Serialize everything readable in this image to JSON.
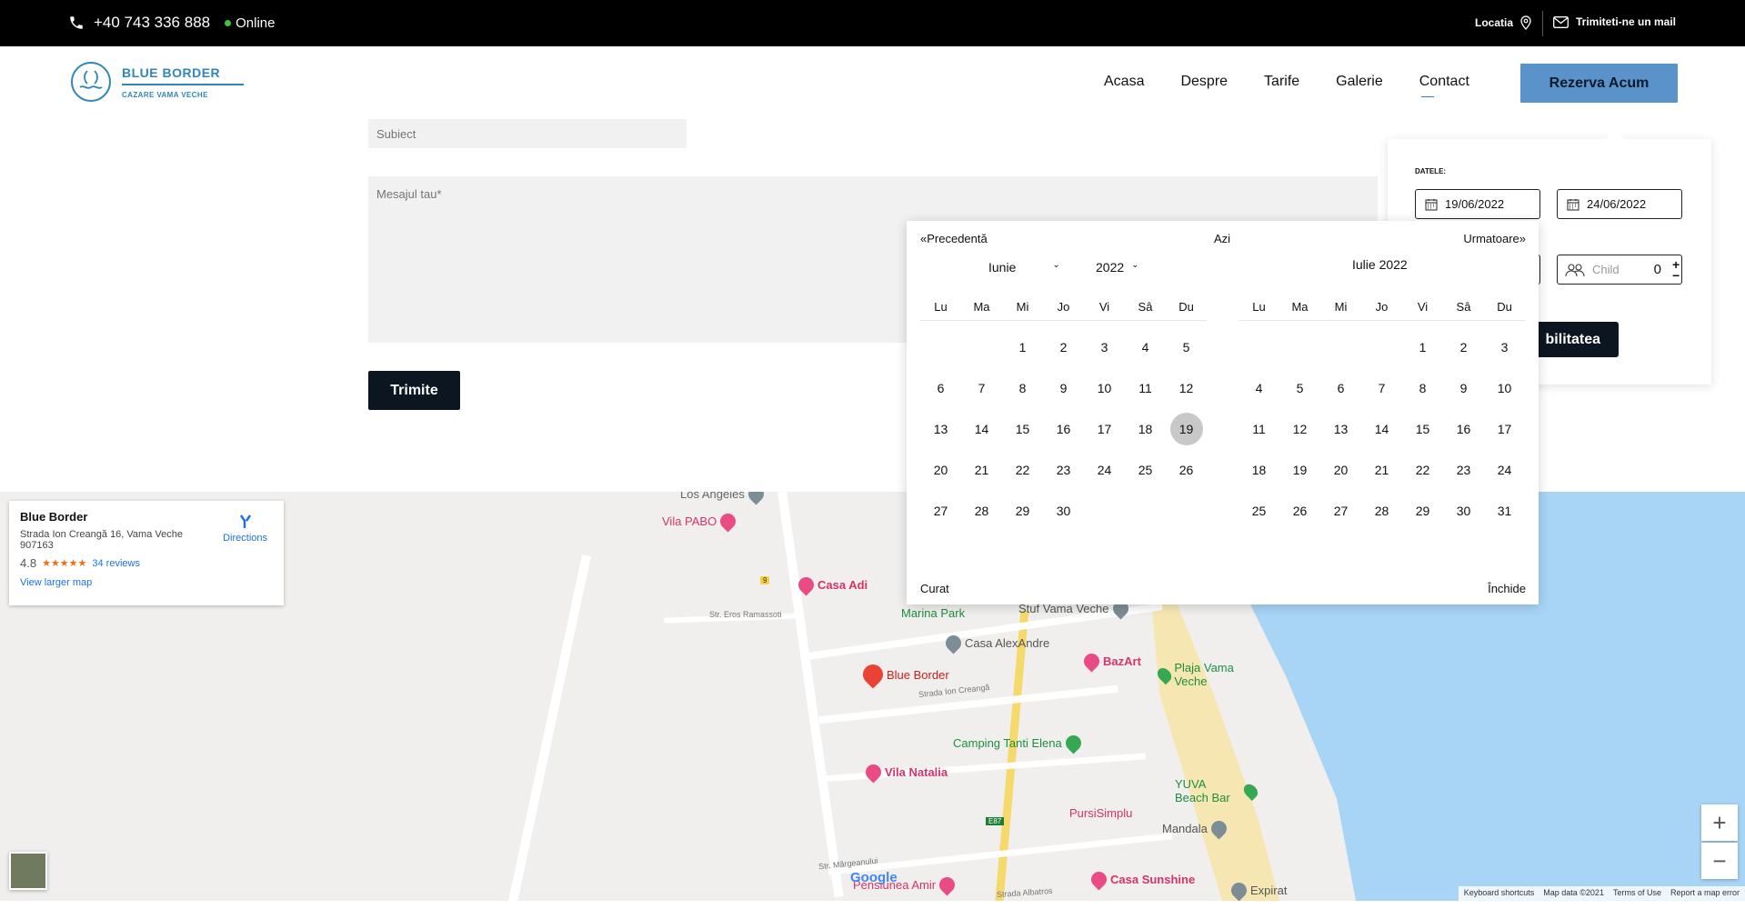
{
  "topbar": {
    "phone": "+40 743 336 888",
    "status": "Online",
    "location_label": "Locatia",
    "mail_label": "Trimiteti-ne un mail"
  },
  "header": {
    "brand": "BLUE BORDER",
    "tagline": "CAZARE VAMA VECHE",
    "nav": [
      "Acasa",
      "Despre",
      "Tarife",
      "Galerie",
      "Contact"
    ],
    "active_nav": "Contact",
    "cta": "Rezerva Acum"
  },
  "form": {
    "subject_placeholder": "Subiect",
    "message_placeholder": "Mesajul tau*",
    "submit": "Trimite"
  },
  "booking": {
    "dates_label": "DATELE:",
    "checkin": "19/06/2022",
    "checkout": "24/06/2022",
    "child_placeholder": "Child",
    "child_value": "0",
    "availability_button": "bilitatea"
  },
  "calendar": {
    "prev": "«Precedentă",
    "today": "Azi",
    "next": "Urmatoare»",
    "month_select": "Iunie",
    "year_select": "2022",
    "second_month_title": "Iulie 2022",
    "weekdays": [
      "Lu",
      "Ma",
      "Mi",
      "Jo",
      "Vi",
      "Sâ",
      "Du"
    ],
    "month1_lead": 2,
    "month1_days": 30,
    "month2_lead": 4,
    "month2_days": 31,
    "selected_day": 19,
    "clear": "Curat",
    "close": "Închide"
  },
  "map": {
    "place_name": "Blue Border",
    "address_line1": "Strada Ion Creangă 16, Vama Veche",
    "address_line2": "907163",
    "rating": "4.8",
    "stars": "★★★★★",
    "reviews": "34 reviews",
    "directions": "Directions",
    "larger_map": "View larger map",
    "pins": {
      "los_angeles": "Los Angeles",
      "vila_pabo": "Vila PABO",
      "casa_adi": "Casa Adi",
      "marina_park": "Marina Park",
      "stuf": "Stuf Vama Veche",
      "alexandre": "Casa AlexAndre",
      "blue_border": "Blue Border",
      "bazart": "BazArt",
      "plaja": "Plaja Vama Veche",
      "camping": "Camping Tanti Elena",
      "vila_natalia": "Vila Natalia",
      "pursi": "PursiSimplu",
      "yuva": "YUVA Beach Bar",
      "mandala": "Mandala",
      "pensiunea": "Pensiunea Amir",
      "sunshine": "Casa Sunshine",
      "expirat": "Expirat"
    },
    "streets": {
      "eros": "Str. Eros Ramassoti",
      "ion_creanga": "Strada Ion Creangă",
      "margeanului": "Str. Mărgeanului",
      "albatros": "Strada Albatros",
      "e87": "E87",
      "route9": "9"
    },
    "google": "Google",
    "footer": [
      "Keyboard shortcuts",
      "Map data ©2021",
      "Terms of Use",
      "Report a map error"
    ]
  },
  "colors": {
    "accent": "#2f86b9",
    "cta": "#5a93c9",
    "dark": "#0b1620",
    "online": "#3ec43e"
  }
}
